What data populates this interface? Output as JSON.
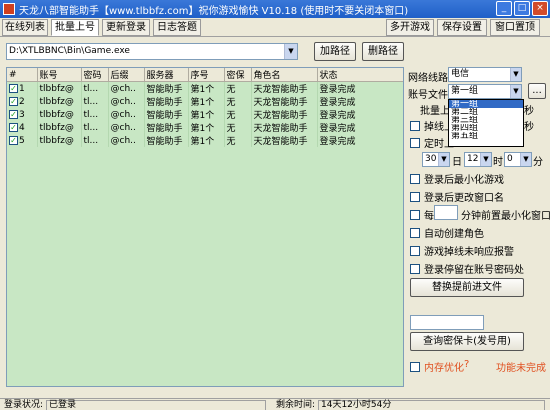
{
  "window": {
    "title": "天龙八部智能助手【www.tlbbfz.com】祝你游戏愉快 V10.18 (使用时不要关闭本窗口)",
    "min_label": "_",
    "max_label": "□",
    "close_label": "×"
  },
  "tabs": [
    {
      "label": "在线列表"
    },
    {
      "label": "批量上号"
    },
    {
      "label": "更新登录"
    },
    {
      "label": "日志答题"
    },
    {
      "label": "多开游戏"
    },
    {
      "label": "保存设置"
    },
    {
      "label": "窗口置顶"
    }
  ],
  "toolbar": {
    "path": "D:\\XTLBBNC\\Bin\\Game.exe",
    "add_path_label": "加路径",
    "del_path_label": "删路径"
  },
  "table": {
    "headers": [
      "#",
      "账号",
      "密码",
      "后缀",
      "服务器",
      "序号",
      "密保",
      "角色名",
      "状态"
    ],
    "rows": [
      {
        "num": "1",
        "account": "tlbbfz@",
        "password": "tl...",
        "suffix": "@ch..",
        "server": "智能助手",
        "index": "第1个",
        "secret": "无",
        "role": "天龙智能助手",
        "status": "登录完成"
      },
      {
        "num": "2",
        "account": "tlbbfz@",
        "password": "tl...",
        "suffix": "@ch..",
        "server": "智能助手",
        "index": "第1个",
        "secret": "无",
        "role": "天龙智能助手",
        "status": "登录完成"
      },
      {
        "num": "3",
        "account": "tlbbfz@",
        "password": "tl...",
        "suffix": "@ch..",
        "server": "智能助手",
        "index": "第1个",
        "secret": "无",
        "role": "天龙智能助手",
        "status": "登录完成"
      },
      {
        "num": "4",
        "account": "tlbbfz@",
        "password": "tl...",
        "suffix": "@ch..",
        "server": "智能助手",
        "index": "第1个",
        "secret": "无",
        "role": "天龙智能助手",
        "status": "登录完成"
      },
      {
        "num": "5",
        "account": "tlbbfz@",
        "password": "tl...",
        "suffix": "@ch..",
        "server": "智能助手",
        "index": "第1个",
        "secret": "无",
        "role": "天龙智能助手",
        "status": "登录完成"
      }
    ]
  },
  "settings": {
    "network_label": "网络线路",
    "network_value": "电信",
    "account_file_label": "账号文件",
    "account_file_value": "第一组",
    "browse_label": "...",
    "account_file_options": [
      "第一组",
      "第二组",
      "第三组",
      "第四组",
      "第五组"
    ],
    "batch_label": "批量上",
    "batch_suffix": "秒",
    "disconnect_label": "掉线上",
    "disconnect_suffix": "秒",
    "timed_label": "定时上",
    "day_value": "30",
    "day_unit": "日",
    "hour_value": "12",
    "hour_unit": "时",
    "minute_value": "0",
    "minute_unit": "分",
    "minimize_after_login": "登录后最小化游戏",
    "rename_after_login": "登录后更改窗口名",
    "every_prefix": "每",
    "every_suffix": "分钟前置最小化窗口",
    "auto_create_role": "自动创建角色",
    "alarm_label": "游戏掉线未响应报警",
    "stop_at_account": "登录停留在账号密码处",
    "replace_file_button": "替换提前进文件",
    "query_card_button": "查询密保卡(发号用)",
    "mem_optimize": "内存优化",
    "question_mark": "?",
    "feature_status": "功能未完成"
  },
  "status": {
    "login_label": "登录状况:",
    "login_value": "已登录",
    "remain_label": "剩余时间:",
    "remain_value": "14天12小时54分"
  },
  "colors": {
    "title_blue": "#1f5fc8",
    "grid_green": "#c8e7c4",
    "warning_red": "#e05020",
    "check_green": "#21a121"
  }
}
